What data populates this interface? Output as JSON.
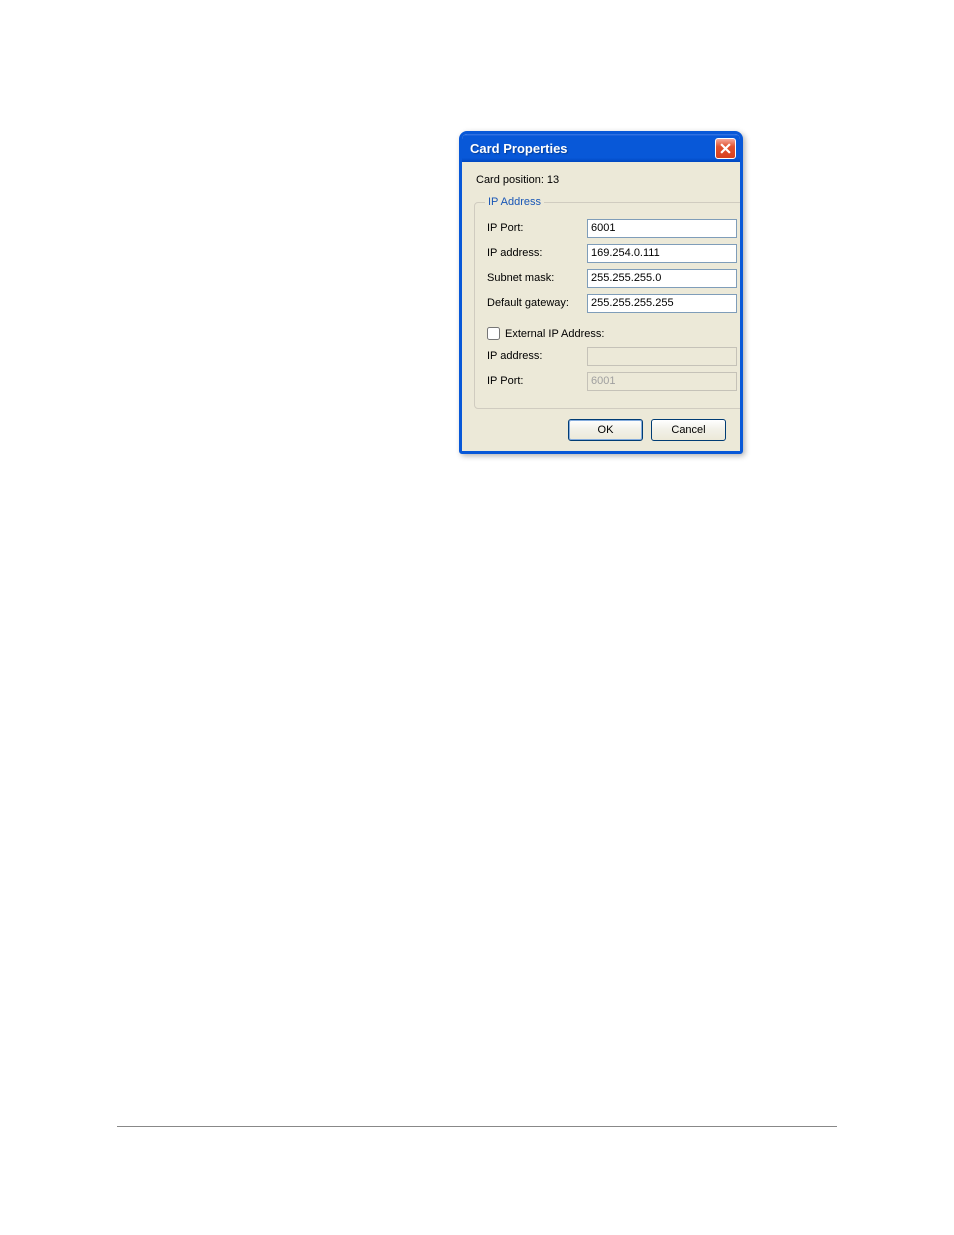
{
  "dialog": {
    "title": "Card Properties",
    "card_position_label": "Card position: 13",
    "groupbox": {
      "legend": "IP Address",
      "ip_port_label": "IP Port:",
      "ip_port_value": "6001",
      "ip_address_label": "IP address:",
      "ip_address_value": "169.254.0.111",
      "subnet_mask_label": "Subnet mask:",
      "subnet_mask_value": "255.255.255.0",
      "default_gateway_label": "Default gateway:",
      "default_gateway_value": "255.255.255.255",
      "external_ip_checkbox_label": "External IP Address:",
      "external_ip_checked": false,
      "external_ip_address_label": "IP address:",
      "external_ip_address_value": "",
      "external_ip_port_label": "IP Port:",
      "external_ip_port_value": "6001"
    },
    "buttons": {
      "ok": "OK",
      "cancel": "Cancel"
    }
  }
}
